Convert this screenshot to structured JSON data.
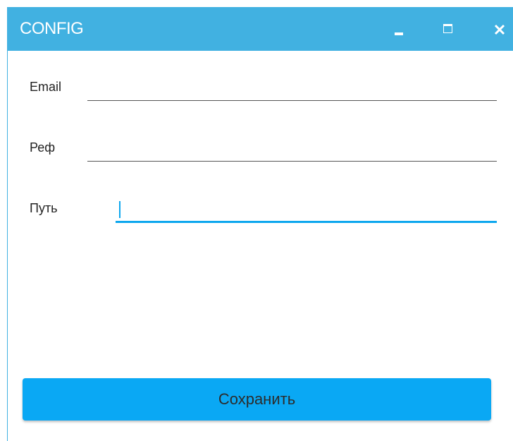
{
  "window": {
    "title": "CONFIG",
    "accent_color": "#41B1E1",
    "controls": {
      "minimize_icon": "minimize-icon",
      "maximize_icon": "maximize-icon",
      "close_icon": "close-icon"
    }
  },
  "form": {
    "email": {
      "label": "Email",
      "value": ""
    },
    "ref": {
      "label": "Реф",
      "value": ""
    },
    "path": {
      "label": "Путь",
      "value": "",
      "focused": true
    }
  },
  "actions": {
    "save_label": "Сохранить",
    "save_color": "#0AA8F4"
  }
}
